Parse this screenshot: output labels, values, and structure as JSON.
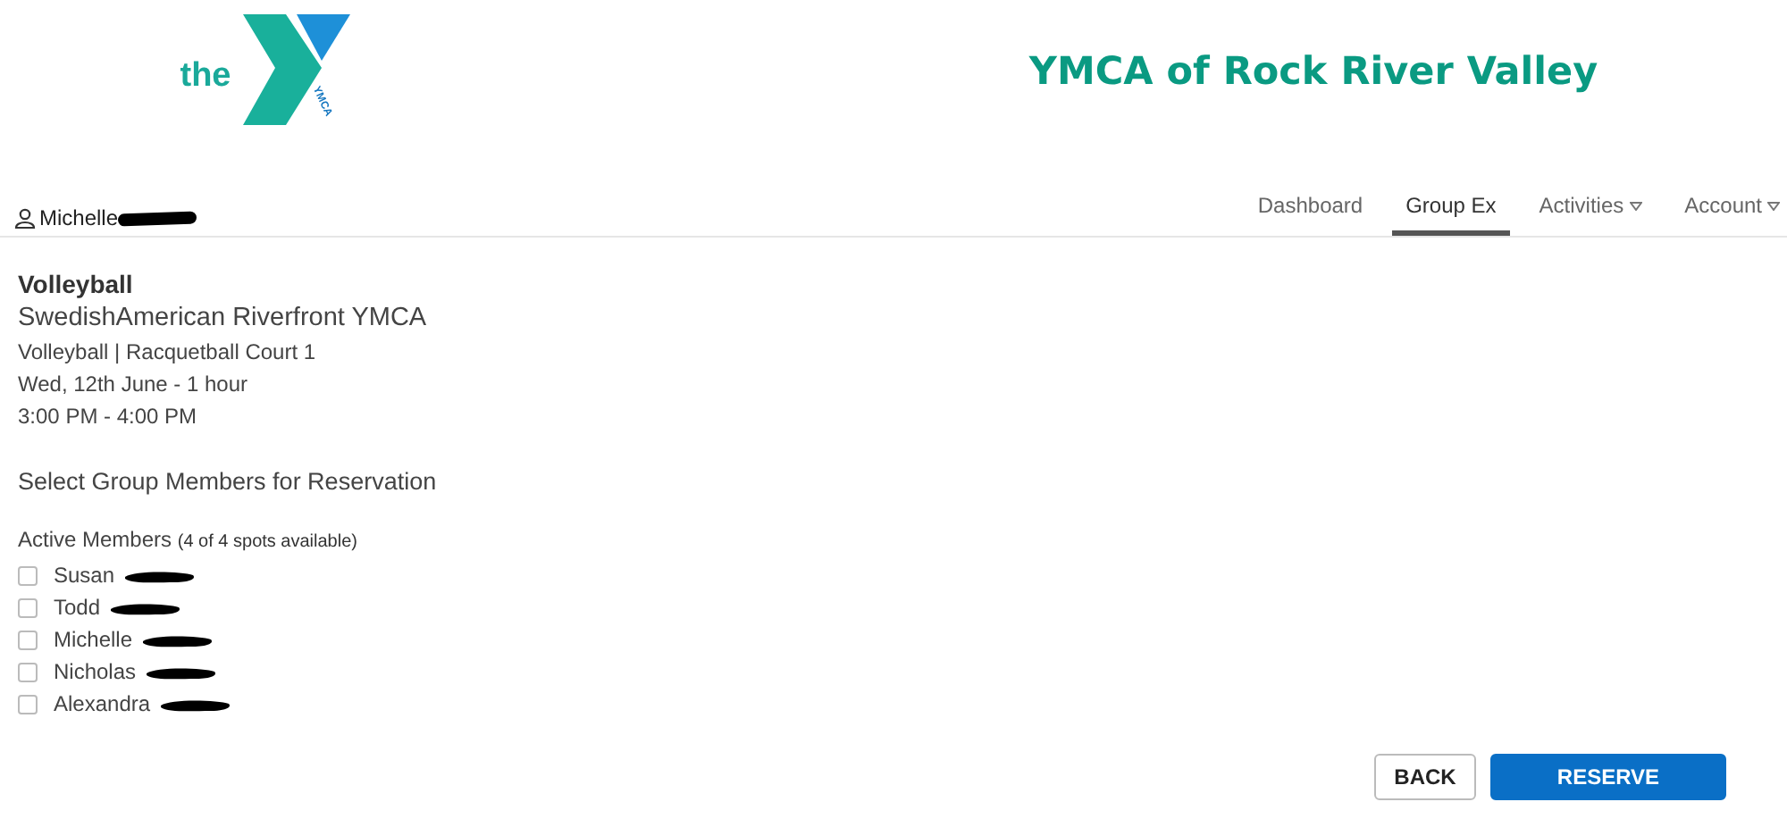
{
  "logo": {
    "prefix": "the",
    "mark_text": "YMCA"
  },
  "site_title": "YMCA of Rock River Valley",
  "user": {
    "name": "Michelle",
    "redacted": true
  },
  "nav": [
    {
      "label": "Dashboard",
      "selected": false,
      "has_menu": false
    },
    {
      "label": "Group Ex",
      "selected": true,
      "has_menu": false
    },
    {
      "label": "Activities",
      "selected": false,
      "has_menu": true
    },
    {
      "label": "Account",
      "selected": false,
      "has_menu": true
    }
  ],
  "class": {
    "title": "Volleyball",
    "location": "SwedishAmerican Riverfront YMCA",
    "details": [
      "Volleyball | Racquetball Court 1",
      "Wed, 12th June - 1 hour",
      "3:00 PM - 4:00 PM"
    ]
  },
  "section_title": "Select Group Members for Reservation",
  "members_heading": {
    "label": "Active Members",
    "note": "(4 of 4 spots available)"
  },
  "members": [
    {
      "name": "Susan",
      "checked": false,
      "redacted": true
    },
    {
      "name": "Todd",
      "checked": false,
      "redacted": true
    },
    {
      "name": "Michelle",
      "checked": false,
      "redacted": true
    },
    {
      "name": "Nicholas",
      "checked": false,
      "redacted": true
    },
    {
      "name": "Alexandra",
      "checked": false,
      "redacted": true
    }
  ],
  "buttons": [
    {
      "label": "BACK",
      "kind": "secondary"
    },
    {
      "label": "RESERVE",
      "kind": "primary"
    }
  ]
}
